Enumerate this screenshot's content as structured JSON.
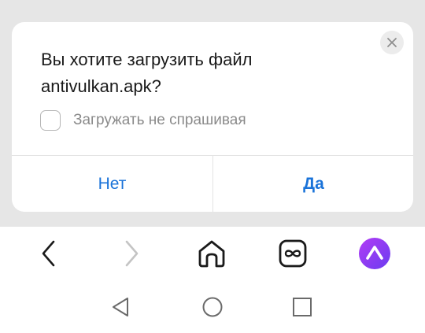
{
  "dialog": {
    "question_line1": "Вы хотите загрузить файл",
    "question_line2": "antivulkan.apk?",
    "checkbox_label": "Загружать не спрашивая",
    "no_label": "Нет",
    "yes_label": "Да",
    "close_icon": "close-icon",
    "accent_color": "#1a73d9"
  },
  "browser_toolbar": {
    "icons": [
      "back-arrow-icon",
      "forward-arrow-icon",
      "home-icon",
      "tabs-icon",
      "alice-assistant-icon"
    ],
    "alice_color": "#8a3ff0"
  },
  "system_nav": {
    "icons": [
      "system-back-icon",
      "system-home-icon",
      "system-recents-icon"
    ]
  }
}
